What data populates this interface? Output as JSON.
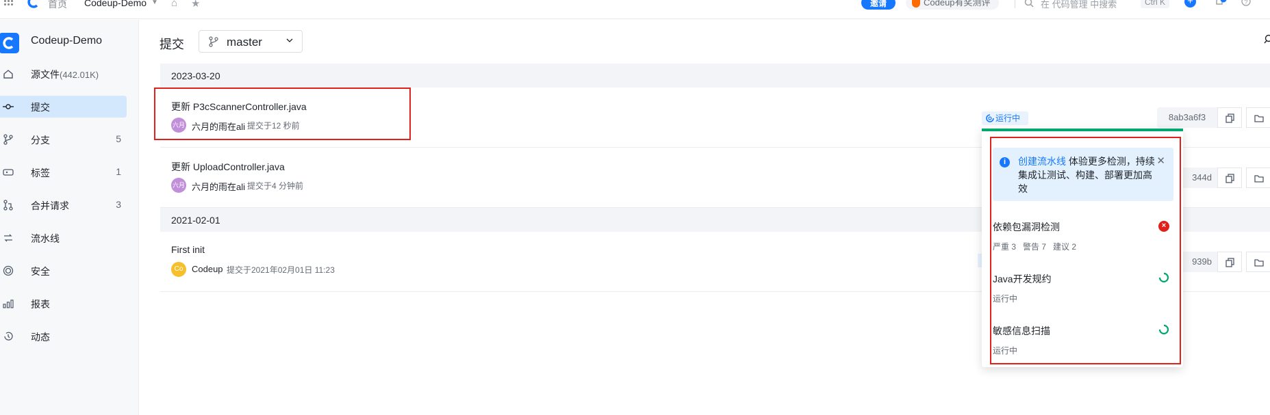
{
  "topbar": {
    "home": "首页",
    "repo": "Codeup-Demo",
    "invite": "邀请",
    "promo": "Codeup有奖测评",
    "search_placeholder": "在 代码管理 中搜索",
    "shortcut": "Ctrl K"
  },
  "sidebar": {
    "repo_name": "Codeup-Demo",
    "items": [
      {
        "label": "源文件",
        "extra": "(442.01K)",
        "icon": "home-icon"
      },
      {
        "label": "提交",
        "icon": "commit-icon",
        "active": true
      },
      {
        "label": "分支",
        "count": "5",
        "icon": "branch-icon"
      },
      {
        "label": "标签",
        "count": "1",
        "icon": "tag-icon"
      },
      {
        "label": "合并请求",
        "count": "3",
        "icon": "merge-request-icon"
      },
      {
        "label": "流水线",
        "icon": "pipeline-icon"
      },
      {
        "label": "安全",
        "icon": "security-icon"
      },
      {
        "label": "报表",
        "icon": "report-icon"
      },
      {
        "label": "动态",
        "icon": "history-icon"
      }
    ]
  },
  "main": {
    "title": "提交",
    "branch": "master",
    "groups": [
      {
        "date": "2023-03-20",
        "commits": [
          {
            "title": "更新 P3cScannerController.java",
            "avatar": "六月",
            "author": "六月的雨在ali",
            "time": "提交于12 秒前",
            "status": "运行中",
            "hash": "8ab3a6f3"
          },
          {
            "title": "更新 UploadController.java",
            "avatar": "六月",
            "author": "六月的雨在ali",
            "time": "提交于4 分钟前",
            "hash": "344d"
          }
        ]
      },
      {
        "date": "2021-02-01",
        "commits": [
          {
            "title": "First init",
            "avatar": "Co",
            "author": "Codeup",
            "time": "提交于2021年02月01日 11:23",
            "hash": "939b"
          }
        ]
      }
    ]
  },
  "popover": {
    "banner_link": "创建流水线",
    "banner_text": " 体验更多检测，持续集成让测试、构建、部署更加高效",
    "checks": [
      {
        "name": "依赖包漏洞检测",
        "detail": "严重 3   警告 7   建议 2",
        "state": "error"
      },
      {
        "name": "Java开发规约",
        "detail": "运行中",
        "state": "running"
      },
      {
        "name": "敏感信息扫描",
        "detail": "运行中",
        "state": "running"
      }
    ]
  },
  "colors": {
    "accent": "#1677ff",
    "success": "#00a870",
    "error": "#e0201b",
    "highlight": "#e0201b"
  }
}
